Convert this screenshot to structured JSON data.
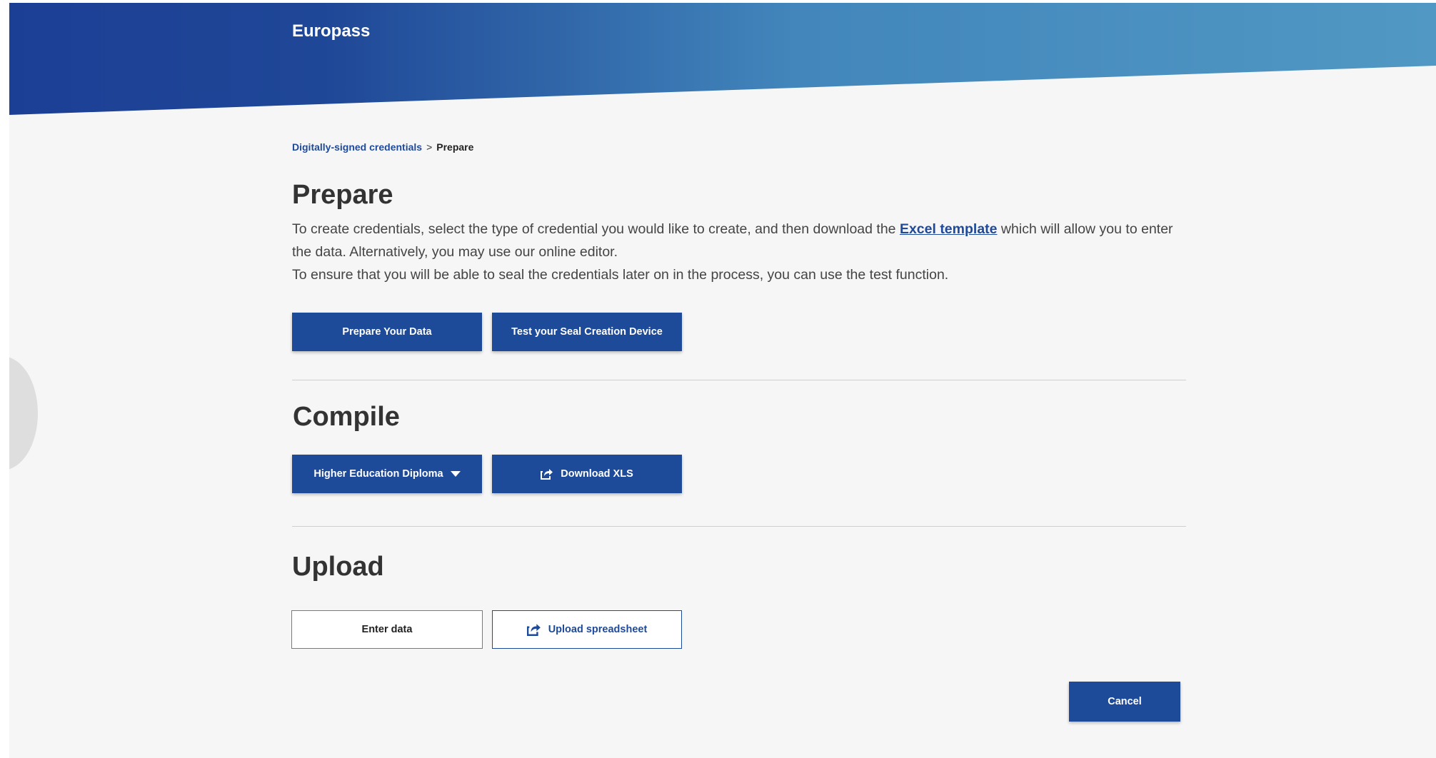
{
  "brand": {
    "name": "Europass"
  },
  "breadcrumb": {
    "link": "Digitally-signed credentials",
    "separator": ">",
    "current": "Prepare"
  },
  "prepare": {
    "title": "Prepare",
    "text_before_link": "To create credentials, select the type of credential you would like to create, and then download the ",
    "link_text": "Excel template",
    "text_after_link": " which will allow you to enter the data. Alternatively, you may use our online editor.",
    "line2": "To ensure that you will be able to seal the credentials later on in the process, you can use the test function.",
    "button_prepare": "Prepare Your Data",
    "button_test": "Test your Seal Creation Device"
  },
  "compile": {
    "title": "Compile",
    "select_value": "Higher Education Diploma",
    "button_download": "Download XLS"
  },
  "upload": {
    "title": "Upload",
    "button_enter": "Enter data",
    "button_upload": "Upload spreadsheet"
  },
  "footer": {
    "cancel_label": "Cancel"
  },
  "colors": {
    "primary": "#1e4a9a",
    "header_dark": "#1c3f96",
    "header_light": "#5198c4",
    "link": "#1f4a9c"
  },
  "icons": {
    "download": "share-arrow-icon",
    "upload": "share-arrow-icon",
    "dropdown": "caret-down-icon"
  }
}
